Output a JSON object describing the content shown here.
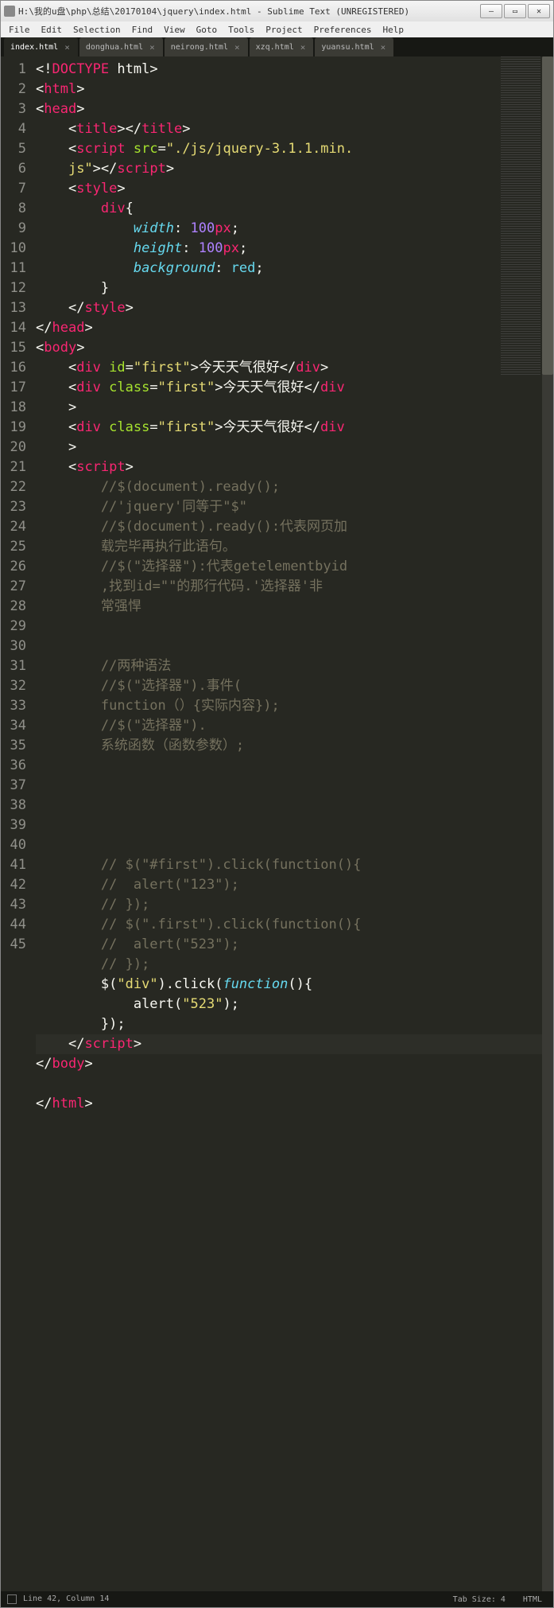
{
  "window": {
    "title": "H:\\我的u盘\\php\\总结\\20170104\\jquery\\index.html - Sublime Text (UNREGISTERED)"
  },
  "menu": {
    "items": [
      "File",
      "Edit",
      "Selection",
      "Find",
      "View",
      "Goto",
      "Tools",
      "Project",
      "Preferences",
      "Help"
    ]
  },
  "tabs": [
    {
      "label": "index.html",
      "active": true
    },
    {
      "label": "donghua.html",
      "active": false
    },
    {
      "label": "neirong.html",
      "active": false
    },
    {
      "label": "xzq.html",
      "active": false
    },
    {
      "label": "yuansu.html",
      "active": false
    }
  ],
  "status": {
    "line_col": "Line 42, Column 14",
    "tab_size": "Tab Size: 4",
    "syntax": "HTML"
  },
  "code_lines": [
    {
      "n": "1",
      "html": "<span class='white'>&lt;!</span><span class='pink'>DOCTYPE</span> <span class='white'>html&gt;</span>"
    },
    {
      "n": "2",
      "html": "<span class='white'>&lt;</span><span class='pink'>html</span><span class='white'>&gt;</span>"
    },
    {
      "n": "3",
      "html": "<span class='white'>&lt;</span><span class='pink'>head</span><span class='white'>&gt;</span>"
    },
    {
      "n": "4",
      "html": "    <span class='white'>&lt;</span><span class='pink'>title</span><span class='white'>&gt;&lt;/</span><span class='pink'>title</span><span class='white'>&gt;</span>"
    },
    {
      "n": "5",
      "html": "    <span class='white'>&lt;</span><span class='pink'>script</span> <span class='green'>src</span><span class='white'>=</span><span class='yellow'>\"./js/jquery-3.1.1.min.</span>"
    },
    {
      "n": "",
      "html": "    <span class='yellow'>js\"</span><span class='white'>&gt;&lt;/</span><span class='pink'>script</span><span class='white'>&gt;</span>"
    },
    {
      "n": "6",
      "html": "    <span class='white'>&lt;</span><span class='pink'>style</span><span class='white'>&gt;</span>"
    },
    {
      "n": "7",
      "html": "        <span class='pink'>div</span><span class='white'>{</span>"
    },
    {
      "n": "8",
      "html": "            <span class='blue'>width</span><span class='white'>: </span><span class='purple'>100</span><span class='pink'>px</span><span class='white'>;</span>"
    },
    {
      "n": "9",
      "html": "            <span class='blue'>height</span><span class='white'>: </span><span class='purple'>100</span><span class='pink'>px</span><span class='white'>;</span>"
    },
    {
      "n": "10",
      "html": "            <span class='blue'>background</span><span class='white'>: </span><span class='blue' style='font-style:normal'>red</span><span class='white'>;</span>"
    },
    {
      "n": "11",
      "html": "        <span class='white'>}</span>"
    },
    {
      "n": "12",
      "html": "    <span class='white'>&lt;/</span><span class='pink'>style</span><span class='white'>&gt;</span>"
    },
    {
      "n": "13",
      "html": "<span class='white'>&lt;/</span><span class='pink'>head</span><span class='white'>&gt;</span>"
    },
    {
      "n": "14",
      "html": "<span class='white'>&lt;</span><span class='pink'>body</span><span class='white'>&gt;</span>"
    },
    {
      "n": "15",
      "html": "    <span class='white'>&lt;</span><span class='pink'>div</span> <span class='green'>id</span><span class='white'>=</span><span class='yellow'>\"first\"</span><span class='white'>&gt;今天天气很好&lt;/</span><span class='pink'>div</span><span class='white'>&gt;</span>"
    },
    {
      "n": "16",
      "html": "    <span class='white'>&lt;</span><span class='pink'>div</span> <span class='green'>class</span><span class='white'>=</span><span class='yellow'>\"first\"</span><span class='white'>&gt;今天天气很好&lt;/</span><span class='pink'>div</span>"
    },
    {
      "n": "",
      "html": "    <span class='white'>&gt;</span>"
    },
    {
      "n": "17",
      "html": "    <span class='white'>&lt;</span><span class='pink'>div</span> <span class='green'>class</span><span class='white'>=</span><span class='yellow'>\"first\"</span><span class='white'>&gt;今天天气很好&lt;/</span><span class='pink'>div</span>"
    },
    {
      "n": "",
      "html": "    <span class='white'>&gt;</span>"
    },
    {
      "n": "18",
      "html": "    <span class='white'>&lt;</span><span class='pink'>script</span><span class='white'>&gt;</span>"
    },
    {
      "n": "19",
      "html": "        <span class='comment'>//$(document).ready();</span>"
    },
    {
      "n": "20",
      "html": "        <span class='comment'>//'jquery'同等于\"$\"</span>"
    },
    {
      "n": "21",
      "html": "        <span class='comment'>//$(document).ready():代表网页加</span>"
    },
    {
      "n": "",
      "html": "        <span class='comment'>载完毕再执行此语句。</span>"
    },
    {
      "n": "22",
      "html": "        <span class='comment'>//$(\"选择器\"):代表getelementbyid</span>"
    },
    {
      "n": "",
      "html": "        <span class='comment'>,找到id=\"\"的那行代码.'选择器'非</span>"
    },
    {
      "n": "",
      "html": "        <span class='comment'>常强悍</span>"
    },
    {
      "n": "23",
      "html": ""
    },
    {
      "n": "24",
      "html": ""
    },
    {
      "n": "25",
      "html": "        <span class='comment'>//两种语法</span>"
    },
    {
      "n": "26",
      "html": "        <span class='comment'>//$(\"选择器\").事件(</span>"
    },
    {
      "n": "",
      "html": "        <span class='comment'>function（）{实际内容});</span>"
    },
    {
      "n": "27",
      "html": "        <span class='comment'>//$(\"选择器\").</span>"
    },
    {
      "n": "",
      "html": "        <span class='comment'>系统函数（函数参数）;</span>"
    },
    {
      "n": "28",
      "html": ""
    },
    {
      "n": "29",
      "html": ""
    },
    {
      "n": "30",
      "html": ""
    },
    {
      "n": "31",
      "html": ""
    },
    {
      "n": "32",
      "html": ""
    },
    {
      "n": "33",
      "html": "        <span class='comment'>// $(\"#first\").click(function(){</span>"
    },
    {
      "n": "34",
      "html": "        <span class='comment'>//  alert(\"123\");</span>"
    },
    {
      "n": "35",
      "html": "        <span class='comment'>// });</span>"
    },
    {
      "n": "36",
      "html": "        <span class='comment'>// $(\".first\").click(function(){</span>"
    },
    {
      "n": "37",
      "html": "        <span class='comment'>//  alert(\"523\");</span>"
    },
    {
      "n": "38",
      "html": "        <span class='comment'>// });</span>"
    },
    {
      "n": "39",
      "html": "        <span class='white'>$(</span><span class='yellow'>\"div\"</span><span class='white'>).click(</span><span class='blue'>function</span><span class='white'>(){</span>"
    },
    {
      "n": "40",
      "html": "            <span class='white'>alert(</span><span class='yellow'>\"523\"</span><span class='white'>);</span>"
    },
    {
      "n": "41",
      "html": "        <span class='white'>});</span>"
    },
    {
      "n": "42",
      "html": "    <span class='white'>&lt;/</span><span class='pink'>script</span><span class='white'>&gt;</span>",
      "cursor": true
    },
    {
      "n": "43",
      "html": "<span class='white'>&lt;/</span><span class='pink'>body</span><span class='white'>&gt;</span>"
    },
    {
      "n": "44",
      "html": ""
    },
    {
      "n": "45",
      "html": "<span class='white'>&lt;/</span><span class='pink'>html</span><span class='white'>&gt;</span>"
    }
  ]
}
